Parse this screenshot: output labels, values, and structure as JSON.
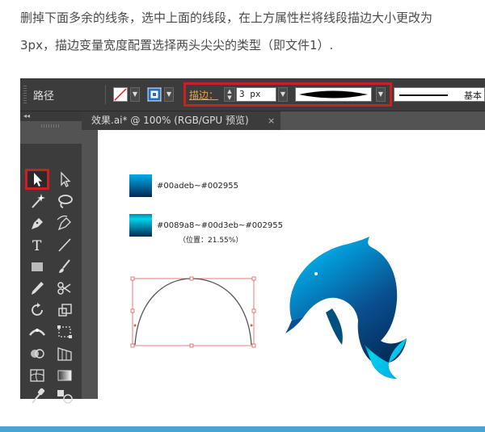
{
  "instructions": {
    "line1": "删掉下面多余的线条，选中上面的线段，在上方属性栏将线段描边大小更改为",
    "line2": "3px，描边变量宽度配置选择两头尖尖的类型（即文件1）."
  },
  "control_bar": {
    "path_label": "路径",
    "stroke_label": "描边：",
    "stroke_value": "3 px",
    "brush_label": "基本"
  },
  "document_tab": {
    "title": "效果.ai* @ 100% (RGB/GPU 预览)",
    "close": "×"
  },
  "panel_header": "◂◂",
  "canvas": {
    "gradient1_label": "#00adeb~#002955",
    "gradient2_label": "#0089a8~#00d3eb~#002955",
    "gradient2_position": "（位置：21.55%）"
  },
  "colors": {
    "highlight": "#cc1f1f",
    "gradient1": [
      "#00adeb",
      "#002955"
    ],
    "gradient2": [
      "#0089a8",
      "#00d3eb",
      "#002955"
    ]
  },
  "tools": [
    "selection-tool",
    "direct-selection-tool",
    "magic-wand-tool",
    "lasso-tool",
    "pen-tool",
    "curvature-tool",
    "type-tool",
    "line-tool",
    "rectangle-tool",
    "paintbrush-tool",
    "pencil-tool",
    "scissors-tool",
    "rotate-tool",
    "scale-tool",
    "width-tool",
    "free-transform-tool",
    "shape-builder-tool",
    "perspective-grid-tool",
    "mesh-tool",
    "gradient-tool",
    "eyedropper-tool",
    "blend-tool",
    "symbol-sprayer-tool",
    "graph-tool"
  ]
}
